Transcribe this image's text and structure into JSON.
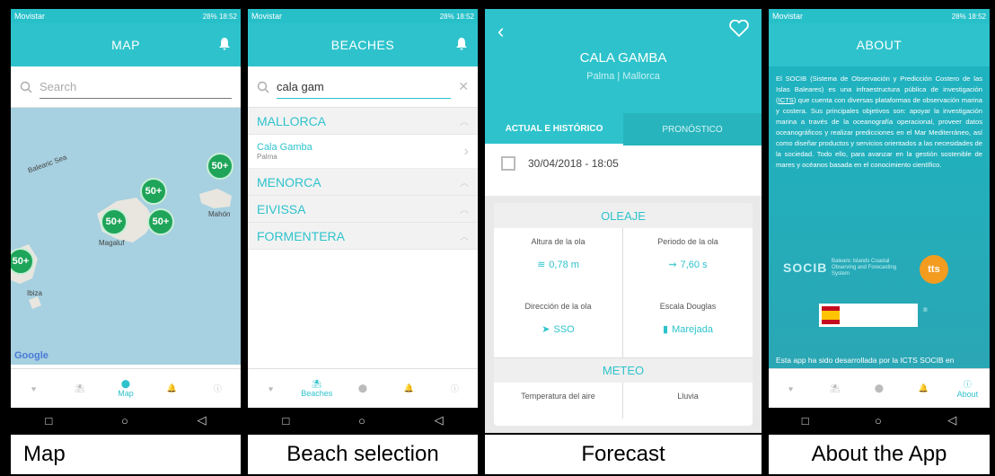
{
  "colors": {
    "accent": "#2ec3cc",
    "cluster": "#1fa55a",
    "about_bg": "#1fb3c0"
  },
  "status": {
    "carrier": "Movistar",
    "right": "28% 18:52"
  },
  "tabs": {
    "map": "Map",
    "beaches": "Beaches",
    "about": "About"
  },
  "screen_map": {
    "title": "MAP",
    "search_placeholder": "Search",
    "clusters": [
      "50+",
      "50+",
      "50+",
      "50+",
      "50+"
    ],
    "labels": [
      "Balearic Sea",
      "Mahón",
      "Magaluf",
      "Ibiza"
    ],
    "google": "Google"
  },
  "screen_beaches": {
    "title": "BEACHES",
    "search_value": "cala gam",
    "sections": [
      "MALLORCA",
      "MENORCA",
      "EIVISSA",
      "FORMENTERA"
    ],
    "result": {
      "name": "Cala Gamba",
      "town": "Palma"
    }
  },
  "screen_forecast": {
    "title": "CALA GAMBA",
    "subtitle": "Palma | Mallorca",
    "tabs": [
      "ACTUAL E HISTÓRICO",
      "PRONÓSTICO"
    ],
    "date": "30/04/2018 - 18:05",
    "waves": {
      "heading": "OLEAJE",
      "height_label": "Altura de la ola",
      "height_value": "0,78 m",
      "period_label": "Periodo de la ola",
      "period_value": "7,60 s",
      "direction_label": "Dirección de la ola",
      "direction_value": "SSO",
      "douglas_label": "Escala Douglas",
      "douglas_value": "Marejada"
    },
    "meteo": {
      "heading": "METEO",
      "temp_label": "Temperatura del aire",
      "rain_label": "Lluvia"
    }
  },
  "screen_about": {
    "title": "ABOUT",
    "text_before": "El SOCIB (Sistema de Observación y Predicción Costero de las Islas Baleares) es una infraestructura pública de investigación (",
    "text_link": "ICTS",
    "text_after": ") que cuenta con diversas plataformas de observación marina y costera. Sus principales objetivos son: apoyar la investigación marina a través de la oceanografía operacional, proveer datos oceanográficos y realizar predicciones en el Mar Mediterráneo, así como diseñar productos y servicios orientados a las necesidades de la sociedad. Todo ello, para avanzar en la gestión sostenible de mares y océanos basada en el conocimiento científico.",
    "socib_logo": "SOCIB",
    "socib_sub": "Balearic Islands Coastal Observing and Forecasting System",
    "tts_logo": "tts",
    "developed": "Esta app ha sido desarrollada por la ICTS SOCIB en"
  },
  "captions": [
    "Map",
    "Beach selection",
    "Forecast",
    "About the App"
  ]
}
